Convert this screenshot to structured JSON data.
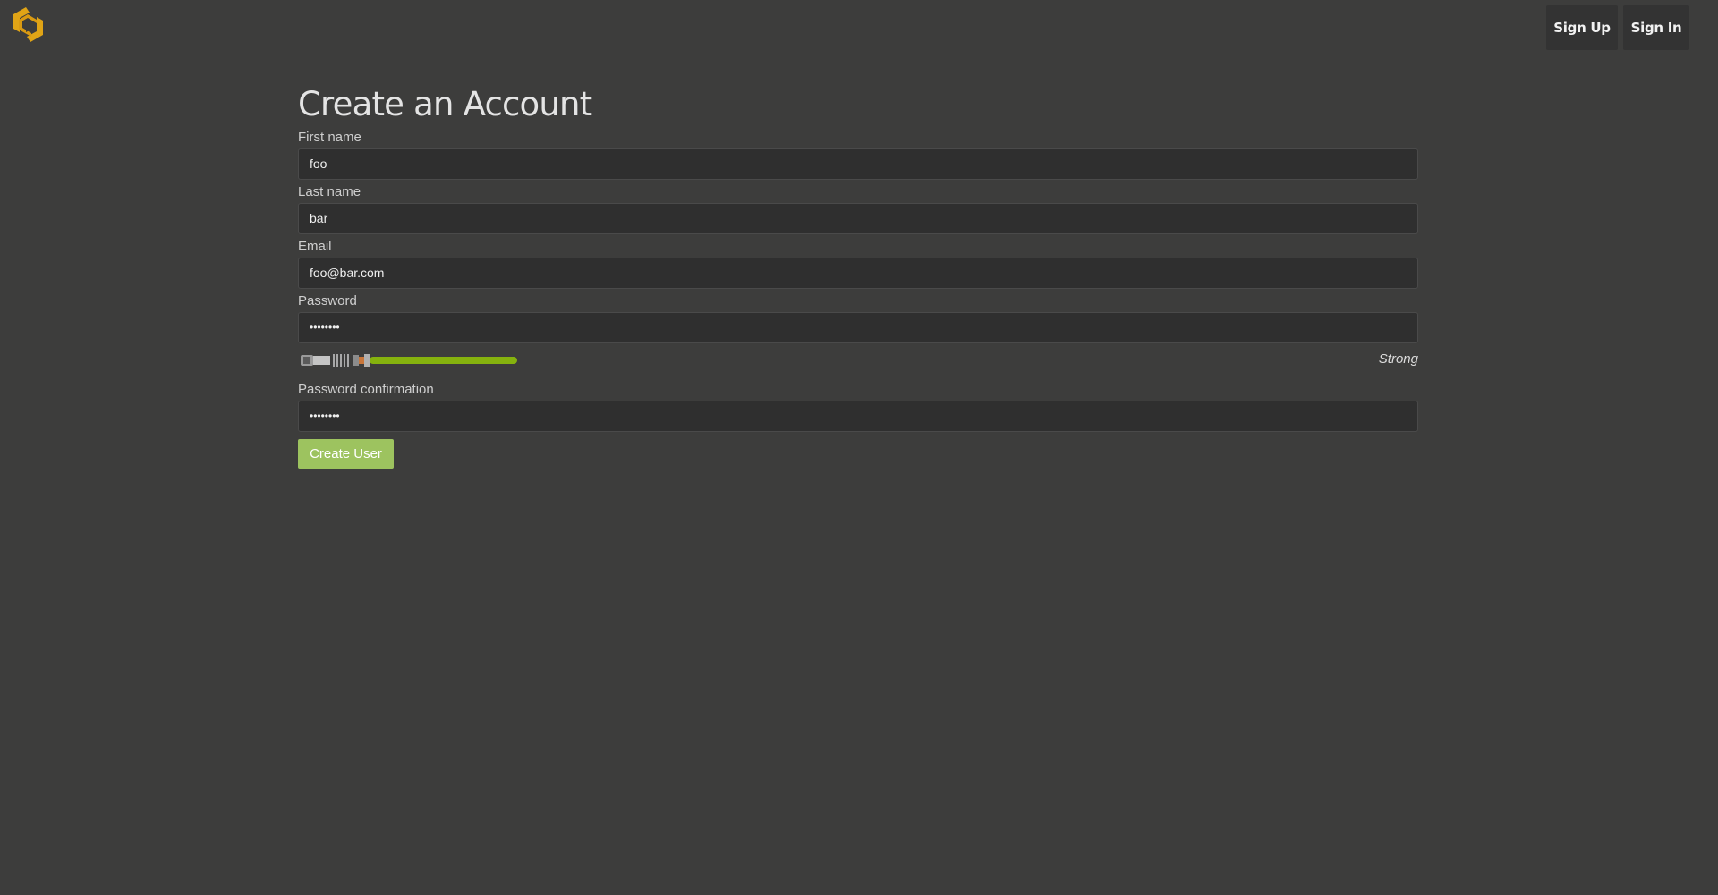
{
  "nav": {
    "signup_label": "Sign Up",
    "signin_label": "Sign In"
  },
  "form": {
    "title": "Create an Account",
    "fields": [
      {
        "label": "First name",
        "value": "foo"
      },
      {
        "label": "Last name",
        "value": "bar"
      },
      {
        "label": "Email",
        "value": "foo@bar.com"
      },
      {
        "label": "Password",
        "value": "••••••••"
      },
      {
        "label": "Password confirmation",
        "value": "••••••••"
      }
    ],
    "strength_text": "Strong",
    "strength_level": "strong",
    "submit_label": "Create User"
  },
  "colors": {
    "background": "#3d3d3c",
    "input_bg": "#2f2f2f",
    "nav_button_bg": "#333333",
    "accent_green": "#9dc35f",
    "saber_blade": "#85b20e",
    "logo": "#e0a416"
  },
  "icons": {
    "logo": "hexagon-logo-icon",
    "strength_meter": "lightsaber-icon"
  }
}
